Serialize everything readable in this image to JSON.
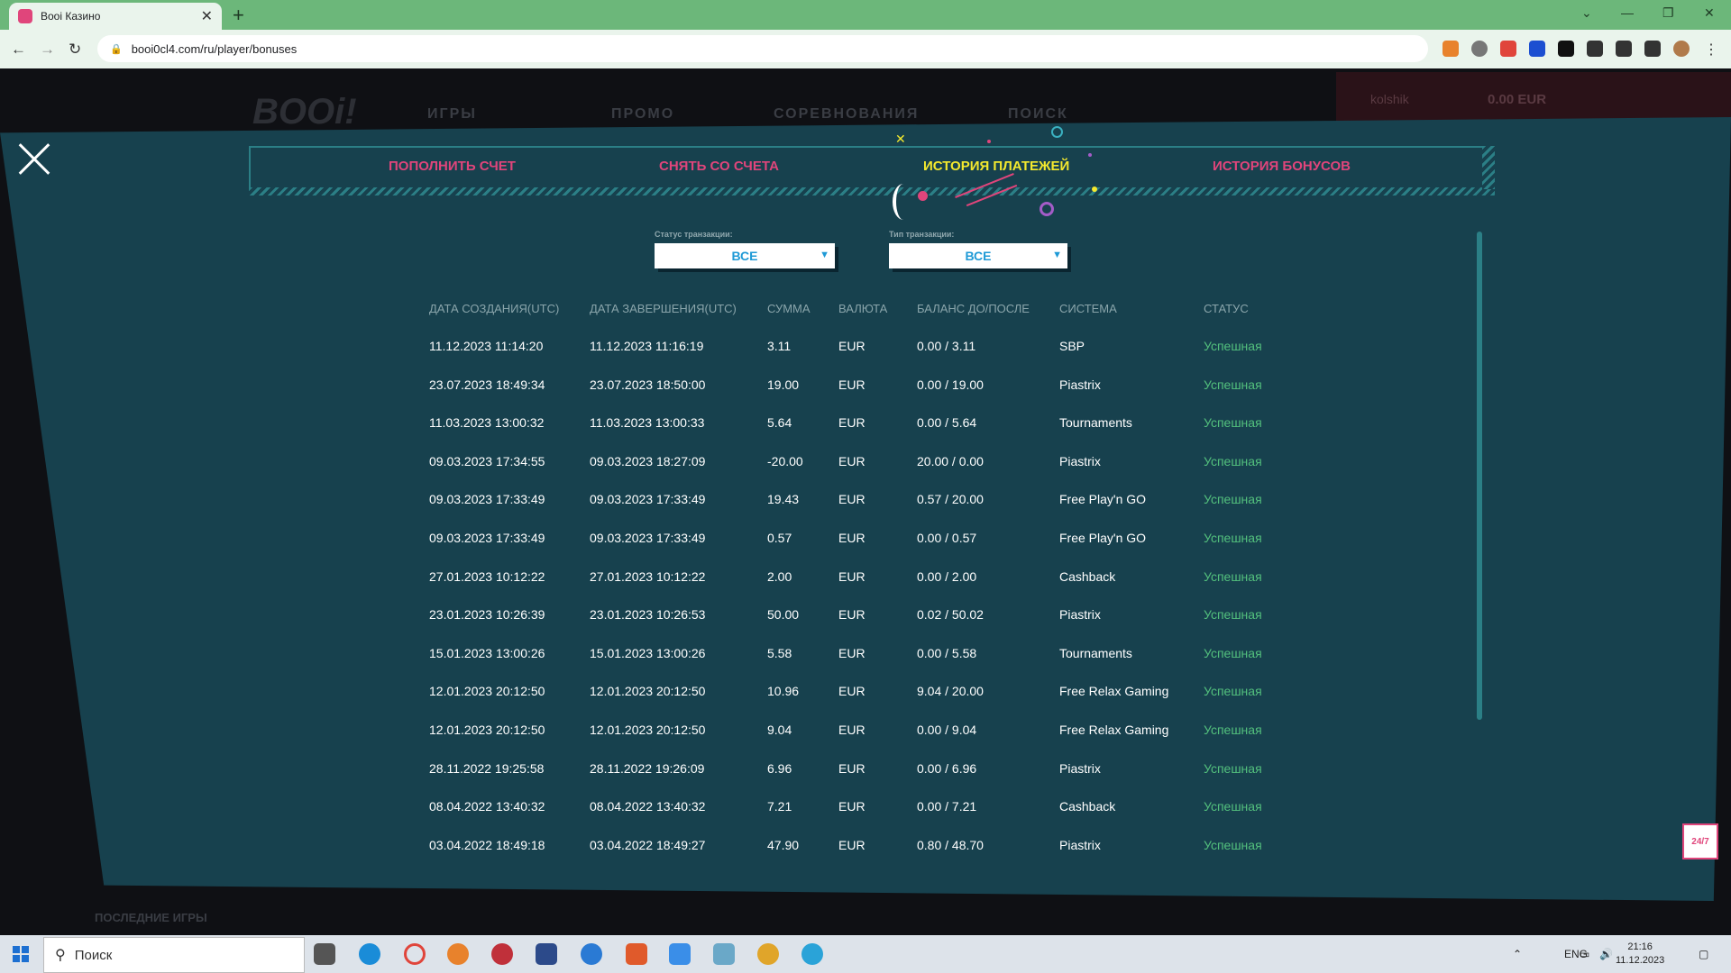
{
  "browser": {
    "tab_title": "Booi Казино",
    "tab_close": "✕",
    "new_tab": "+",
    "url": "booi0cl4.com/ru/player/bonuses",
    "nav_back": "←",
    "nav_forward": "→",
    "nav_reload": "↻",
    "win_min": "—",
    "win_max": "❐",
    "win_close": "✕",
    "win_chevron": "⌄"
  },
  "site": {
    "logo": "BOOi!",
    "nav": [
      "ИГРЫ",
      "ПРОМО",
      "СОРЕВНОВАНИЯ",
      "ПОИСК"
    ],
    "username": "kolshik",
    "balance": "0.00 EUR",
    "recent_games": "ПОСЛЕДНИЕ ИГРЫ"
  },
  "modal": {
    "tabs": [
      "ПОПОЛНИТЬ СЧЕТ",
      "СНЯТЬ СО СЧЕТА",
      "ИСТОРИЯ ПЛАТЕЖЕЙ",
      "ИСТОРИЯ БОНУСОВ"
    ],
    "active_tab": 2,
    "filters": {
      "status_label": "Статус транзакции:",
      "status_value": "ВСЕ",
      "type_label": "Тип транзакции:",
      "type_value": "ВСЕ",
      "arrow": "▼"
    },
    "columns": [
      "ДАТА СОЗДАНИЯ(UTC)",
      "ДАТА ЗАВЕРШЕНИЯ(UTC)",
      "СУММА",
      "ВАЛЮТА",
      "БАЛАНС ДО/ПОСЛЕ",
      "СИСТЕМА",
      "СТАТУС"
    ],
    "rows": [
      [
        "11.12.2023 11:14:20",
        "11.12.2023 11:16:19",
        "3.11",
        "EUR",
        "0.00 / 3.11",
        "SBP",
        "Успешная"
      ],
      [
        "23.07.2023 18:49:34",
        "23.07.2023 18:50:00",
        "19.00",
        "EUR",
        "0.00 / 19.00",
        "Piastrix",
        "Успешная"
      ],
      [
        "11.03.2023 13:00:32",
        "11.03.2023 13:00:33",
        "5.64",
        "EUR",
        "0.00 / 5.64",
        "Tournaments",
        "Успешная"
      ],
      [
        "09.03.2023 17:34:55",
        "09.03.2023 18:27:09",
        "-20.00",
        "EUR",
        "20.00 / 0.00",
        "Piastrix",
        "Успешная"
      ],
      [
        "09.03.2023 17:33:49",
        "09.03.2023 17:33:49",
        "19.43",
        "EUR",
        "0.57 / 20.00",
        "Free Play'n GO",
        "Успешная"
      ],
      [
        "09.03.2023 17:33:49",
        "09.03.2023 17:33:49",
        "0.57",
        "EUR",
        "0.00 / 0.57",
        "Free Play'n GO",
        "Успешная"
      ],
      [
        "27.01.2023 10:12:22",
        "27.01.2023 10:12:22",
        "2.00",
        "EUR",
        "0.00 / 2.00",
        "Cashback",
        "Успешная"
      ],
      [
        "23.01.2023 10:26:39",
        "23.01.2023 10:26:53",
        "50.00",
        "EUR",
        "0.02 / 50.02",
        "Piastrix",
        "Успешная"
      ],
      [
        "15.01.2023 13:00:26",
        "15.01.2023 13:00:26",
        "5.58",
        "EUR",
        "0.00 / 5.58",
        "Tournaments",
        "Успешная"
      ],
      [
        "12.01.2023 20:12:50",
        "12.01.2023 20:12:50",
        "10.96",
        "EUR",
        "9.04 / 20.00",
        "Free Relax Gaming",
        "Успешная"
      ],
      [
        "12.01.2023 20:12:50",
        "12.01.2023 20:12:50",
        "9.04",
        "EUR",
        "0.00 / 9.04",
        "Free Relax Gaming",
        "Успешная"
      ],
      [
        "28.11.2022 19:25:58",
        "28.11.2022 19:26:09",
        "6.96",
        "EUR",
        "0.00 / 6.96",
        "Piastrix",
        "Успешная"
      ],
      [
        "08.04.2022 13:40:32",
        "08.04.2022 13:40:32",
        "7.21",
        "EUR",
        "0.00 / 7.21",
        "Cashback",
        "Успешная"
      ],
      [
        "03.04.2022 18:49:18",
        "03.04.2022 18:49:27",
        "47.90",
        "EUR",
        "0.80 / 48.70",
        "Piastrix",
        "Успешная"
      ]
    ],
    "support": "24/7",
    "close": ""
  },
  "taskbar": {
    "search": "Поиск",
    "search_icon": "⚲",
    "lang": "ENG",
    "time": "21:16",
    "date": "11.12.2023"
  },
  "colors": {
    "modal_bg": "#17414e",
    "tab_pink": "#e0457b",
    "tab_active": "#f4e92e",
    "status_ok": "#53c07d",
    "select_text": "#1f9ad6"
  }
}
